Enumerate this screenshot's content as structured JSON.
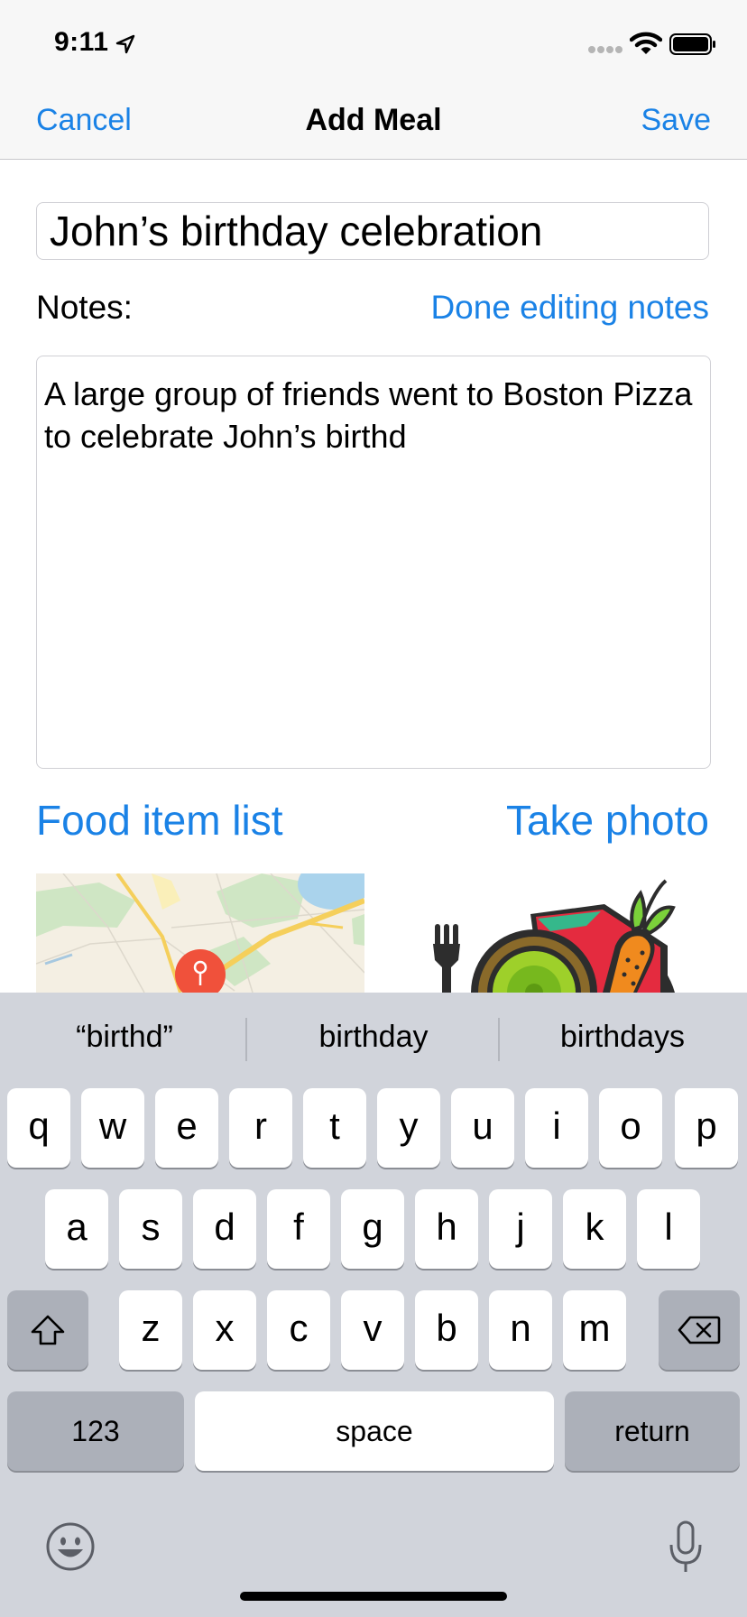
{
  "status_bar": {
    "time": "9:11",
    "icons": [
      "location-arrow-icon",
      "signal-dots-icon",
      "wifi-icon",
      "battery-icon"
    ]
  },
  "nav": {
    "cancel_label": "Cancel",
    "title": "Add Meal",
    "save_label": "Save"
  },
  "form": {
    "meal_name_value": "John’s birthday celebration",
    "notes_label": "Notes:",
    "done_editing_label": "Done editing notes",
    "notes_value": "A large group of friends went to Boston Pizza to celebrate John’s birthd",
    "food_list_label": "Food item list",
    "take_photo_label": "Take photo"
  },
  "keyboard": {
    "suggestions": [
      "“birthd”",
      "birthday",
      "birthdays"
    ],
    "row1": [
      "q",
      "w",
      "e",
      "r",
      "t",
      "y",
      "u",
      "i",
      "o",
      "p"
    ],
    "row2": [
      "a",
      "s",
      "d",
      "f",
      "g",
      "h",
      "j",
      "k",
      "l"
    ],
    "row3": [
      "z",
      "x",
      "c",
      "v",
      "b",
      "n",
      "m"
    ],
    "numbers_label": "123",
    "space_label": "space",
    "return_label": "return"
  },
  "colors": {
    "accent": "#1a82e6",
    "keyboard_bg": "#d1d4db",
    "dark_key": "#acb0b9"
  }
}
